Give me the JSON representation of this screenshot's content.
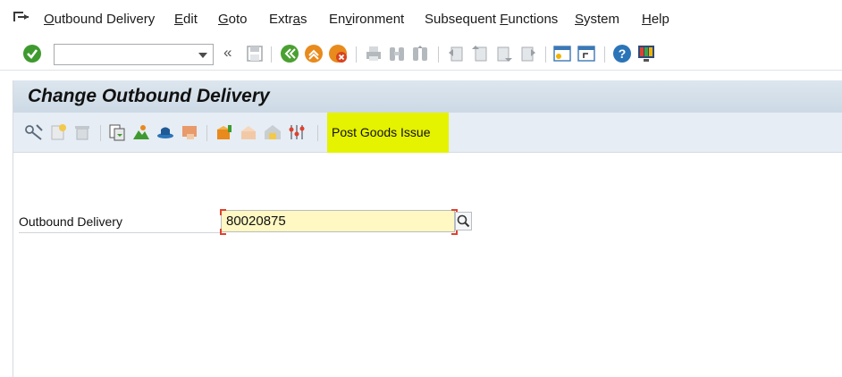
{
  "menu": {
    "items": [
      {
        "pre": "",
        "u": "O",
        "post": "utbound Delivery"
      },
      {
        "pre": "",
        "u": "E",
        "post": "dit"
      },
      {
        "pre": "",
        "u": "G",
        "post": "oto"
      },
      {
        "pre": "Extr",
        "u": "a",
        "post": "s"
      },
      {
        "pre": "En",
        "u": "v",
        "post": "ironment"
      },
      {
        "pre": "Subsequent ",
        "u": "F",
        "post": "unctions"
      },
      {
        "pre": "",
        "u": "S",
        "post": "ystem"
      },
      {
        "pre": "",
        "u": "H",
        "post": "elp"
      }
    ]
  },
  "toolbar": {
    "command_value": "",
    "prev_glyph": "«"
  },
  "screen": {
    "title": "Change Outbound Delivery"
  },
  "app_toolbar": {
    "post_goods_issue_label": "Post Goods Issue"
  },
  "form": {
    "outbound_delivery_label": "Outbound Delivery",
    "outbound_delivery_value": "80020875"
  },
  "colors": {
    "highlight": "#e5f200",
    "title_bg": "#d4dfe9",
    "input_bg": "#fff8c3",
    "enter_green": "#3e9a2f",
    "back_green": "#4aa030",
    "exit_orange": "#e98a1c",
    "cancel_red": "#d9421f"
  }
}
